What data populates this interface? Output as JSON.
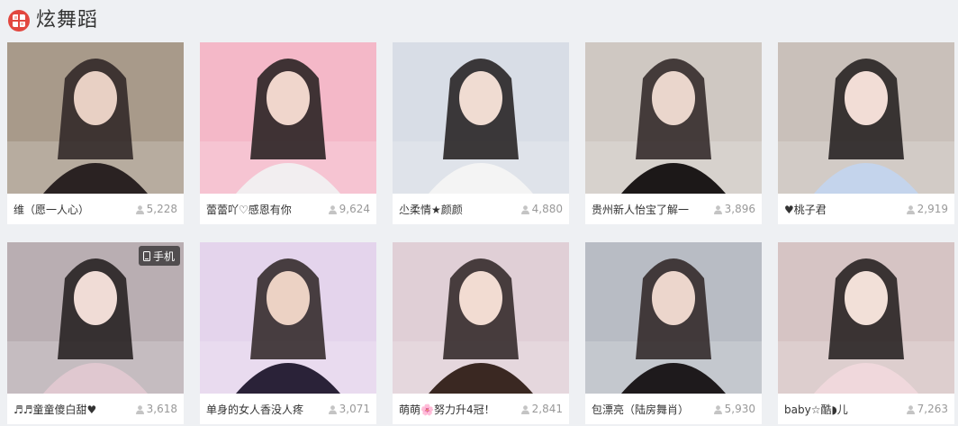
{
  "section": {
    "title": "炫舞蹈",
    "icon": "logo-ball-icon"
  },
  "mobile_badge_label": "手机",
  "cards": [
    {
      "name": "维（愿一人心）",
      "viewers": "5,228",
      "bg": "#a89a8a",
      "figure": "#2a2222",
      "skin": "#e8d0c4"
    },
    {
      "name": "蕾蕾吖♡感恩有你",
      "viewers": "9,624",
      "bg": "#f4b8c8",
      "figure": "#f2eef0",
      "skin": "#f0d6cc"
    },
    {
      "name": "尐柔情★颜颜",
      "viewers": "4,880",
      "bg": "#d8dde6",
      "figure": "#f4f4f4",
      "skin": "#f0dcd2"
    },
    {
      "name": "贵州新人怡宝了解一",
      "viewers": "3,896",
      "bg": "#cfc8c2",
      "figure": "#1c1818",
      "skin": "#ead6cc"
    },
    {
      "name": "♥桃子君",
      "viewers": "2,919",
      "bg": "#c9c0ba",
      "figure": "#c4d4ec",
      "skin": "#f2ddd6"
    },
    {
      "name": "♬♬童童傻白甜♥",
      "viewers": "3,618",
      "bg": "#b9aeb2",
      "figure": "#e0c8d0",
      "skin": "#f0dcd6",
      "mobile": true
    },
    {
      "name": "单身的女人香没人疼",
      "viewers": "3,071",
      "bg": "#e4d4ec",
      "figure": "#2a2238",
      "skin": "#ecd2c4"
    },
    {
      "name": "萌萌🌸努力升4冠！",
      "viewers": "2,841",
      "bg": "#e0cfd6",
      "figure": "#3a2822",
      "skin": "#f2dcd2"
    },
    {
      "name": "包漂亮（陆房舞肖）",
      "viewers": "5,930",
      "bg": "#b8bcc4",
      "figure": "#1e1a1c",
      "skin": "#ecd6cc"
    },
    {
      "name": "baby☆酷◗儿",
      "viewers": "7,263",
      "bg": "#d6c4c4",
      "figure": "#f0d8dc",
      "skin": "#f2e0d8"
    }
  ]
}
